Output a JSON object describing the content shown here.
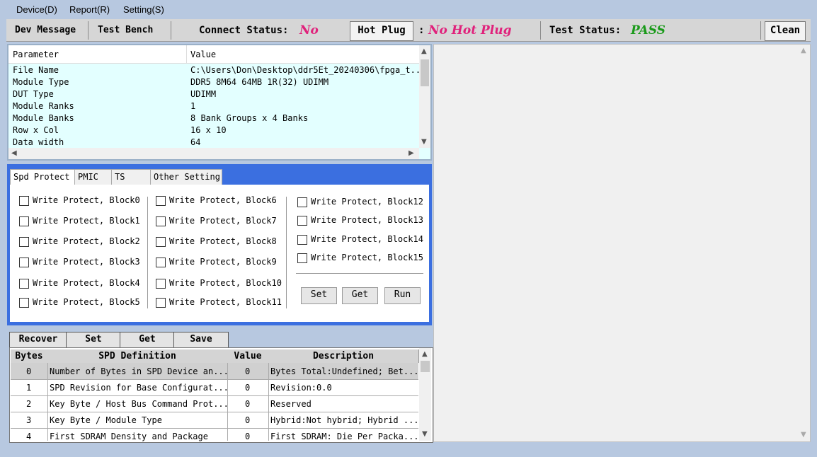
{
  "menu": [
    "Device(D)",
    "Report(R)",
    "Setting(S)"
  ],
  "toolbar": {
    "dev_message": "Dev Message",
    "test_bench": "Test Bench",
    "connect_label": "Connect Status:",
    "connect_value": "No",
    "hot_plug_btn": "Hot Plug",
    "hot_plug_sep": ":",
    "hot_plug_value": "No Hot Plug",
    "test_status_label": "Test Status:",
    "test_status_value": "PASS",
    "clean_btn": "Clean"
  },
  "colors": {
    "connect": "#e0217b",
    "pass": "#1a9a1a",
    "tab_strip": "#3b6fe0",
    "list_bg": "#e3ffff"
  },
  "params": {
    "col_param": "Parameter",
    "col_value": "Value",
    "rows": [
      {
        "k": "File Name",
        "v": "C:\\Users\\Don\\Desktop\\ddr5Et_20240306\\fpga_t..."
      },
      {
        "k": "Module Type",
        "v": "DDR5 8M64 64MB 1R(32) UDIMM"
      },
      {
        "k": "DUT Type",
        "v": "UDIMM"
      },
      {
        "k": "Module Ranks",
        "v": "1"
      },
      {
        "k": "Module Banks",
        "v": "8 Bank Groups x 4 Banks"
      },
      {
        "k": "Row x Col",
        "v": "16 x 10"
      },
      {
        "k": "Data width",
        "v": "64"
      }
    ]
  },
  "tabs": [
    "Spd Protect",
    "PMIC",
    "TS",
    "Other Setting"
  ],
  "protect": {
    "blocks": [
      "Write Protect, Block0",
      "Write Protect, Block1",
      "Write Protect, Block2",
      "Write Protect, Block3",
      "Write Protect, Block4",
      "Write Protect, Block5",
      "Write Protect, Block6",
      "Write Protect, Block7",
      "Write Protect, Block8",
      "Write Protect, Block9",
      "Write Protect, Block10",
      "Write Protect, Block11",
      "Write Protect, Block12",
      "Write Protect, Block13",
      "Write Protect, Block14",
      "Write Protect, Block15"
    ],
    "set": "Set",
    "get": "Get",
    "run": "Run"
  },
  "spd": {
    "buttons": [
      "Recover",
      "Set",
      "Get",
      "Save"
    ],
    "headers": [
      "Bytes",
      "SPD Definition",
      "Value",
      "Description"
    ],
    "rows": [
      {
        "b": "0",
        "d": "Number of Bytes in SPD Device an...",
        "v": "0",
        "desc": "Bytes Total:Undefined; Bet..."
      },
      {
        "b": "1",
        "d": "SPD Revision for Base Configurat...",
        "v": "0",
        "desc": "Revision:0.0"
      },
      {
        "b": "2",
        "d": "Key Byte / Host Bus Command Prot...",
        "v": "0",
        "desc": "Reserved"
      },
      {
        "b": "3",
        "d": "Key Byte / Module Type",
        "v": "0",
        "desc": "Hybrid:Not hybrid; Hybrid ..."
      },
      {
        "b": "4",
        "d": "First SDRAM Density and Package",
        "v": "0",
        "desc": "First SDRAM: Die Per Packa..."
      }
    ]
  }
}
